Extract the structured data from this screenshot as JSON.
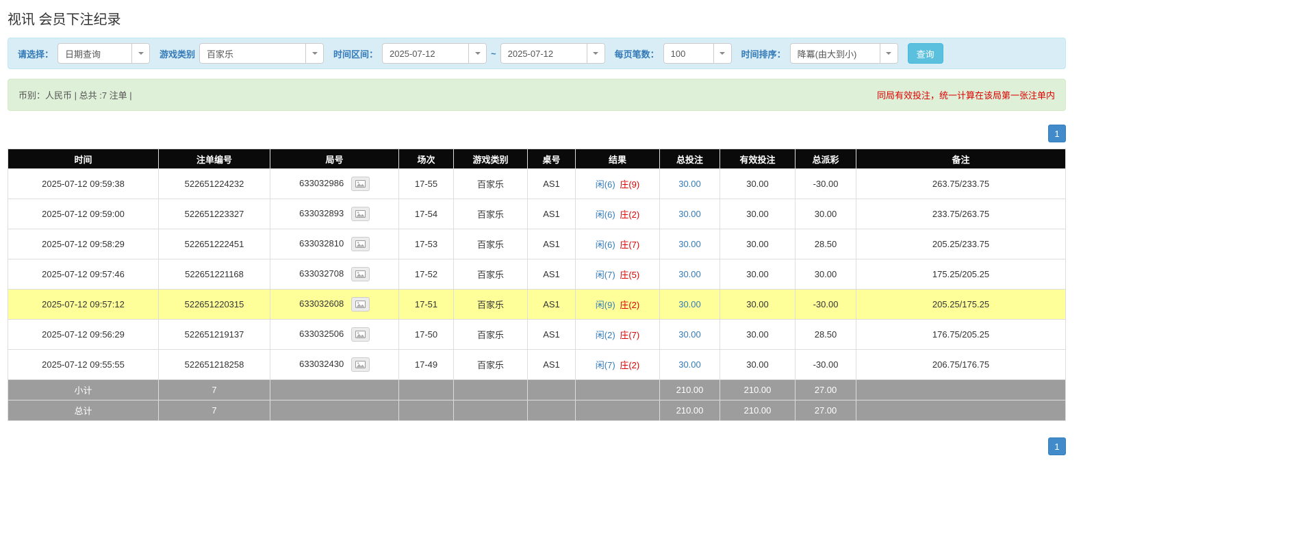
{
  "page": {
    "title": "视讯 会员下注纪录"
  },
  "filter": {
    "select_label": "请选择：",
    "select_value": "日期查询",
    "game_label": "游戏类别",
    "game_value": "百家乐",
    "range_label": "时间区间：",
    "date_from": "2025-07-12",
    "tilde": "~",
    "date_to": "2025-07-12",
    "page_size_label": "每页笔数：",
    "page_size_value": "100",
    "sort_label": "时间排序：",
    "sort_value": "降冪(由大到小)",
    "search_label": "查询"
  },
  "summary": {
    "currency_text": "币别：人民币 | 总共 :7 注单 |",
    "notice_text": "同局有效投注，统一计算在该局第一张注单内"
  },
  "pagination": {
    "page_label": "1"
  },
  "table": {
    "headers": [
      "时间",
      "注单编号",
      "局号",
      "场次",
      "游戏类别",
      "桌号",
      "结果",
      "总投注",
      "有效投注",
      "总派彩",
      "备注"
    ],
    "rows": [
      {
        "time": "2025-07-12 09:59:38",
        "bet_id": "522651224232",
        "round_id": "633032986",
        "session": "17-55",
        "game": "百家乐",
        "table_no": "AS1",
        "result_player": "闲(6)",
        "result_banker": "庄(9)",
        "total_bet": "30.00",
        "valid_bet": "30.00",
        "payout": "-30.00",
        "remark": "263.75/233.75",
        "highlighted": false
      },
      {
        "time": "2025-07-12 09:59:00",
        "bet_id": "522651223327",
        "round_id": "633032893",
        "session": "17-54",
        "game": "百家乐",
        "table_no": "AS1",
        "result_player": "闲(6)",
        "result_banker": "庄(2)",
        "total_bet": "30.00",
        "valid_bet": "30.00",
        "payout": "30.00",
        "remark": "233.75/263.75",
        "highlighted": false
      },
      {
        "time": "2025-07-12 09:58:29",
        "bet_id": "522651222451",
        "round_id": "633032810",
        "session": "17-53",
        "game": "百家乐",
        "table_no": "AS1",
        "result_player": "闲(6)",
        "result_banker": "庄(7)",
        "total_bet": "30.00",
        "valid_bet": "30.00",
        "payout": "28.50",
        "remark": "205.25/233.75",
        "highlighted": false
      },
      {
        "time": "2025-07-12 09:57:46",
        "bet_id": "522651221168",
        "round_id": "633032708",
        "session": "17-52",
        "game": "百家乐",
        "table_no": "AS1",
        "result_player": "闲(7)",
        "result_banker": "庄(5)",
        "total_bet": "30.00",
        "valid_bet": "30.00",
        "payout": "30.00",
        "remark": "175.25/205.25",
        "highlighted": false
      },
      {
        "time": "2025-07-12 09:57:12",
        "bet_id": "522651220315",
        "round_id": "633032608",
        "session": "17-51",
        "game": "百家乐",
        "table_no": "AS1",
        "result_player": "闲(9)",
        "result_banker": "庄(2)",
        "total_bet": "30.00",
        "valid_bet": "30.00",
        "payout": "-30.00",
        "remark": "205.25/175.25",
        "highlighted": true
      },
      {
        "time": "2025-07-12 09:56:29",
        "bet_id": "522651219137",
        "round_id": "633032506",
        "session": "17-50",
        "game": "百家乐",
        "table_no": "AS1",
        "result_player": "闲(2)",
        "result_banker": "庄(7)",
        "total_bet": "30.00",
        "valid_bet": "30.00",
        "payout": "28.50",
        "remark": "176.75/205.25",
        "highlighted": false
      },
      {
        "time": "2025-07-12 09:55:55",
        "bet_id": "522651218258",
        "round_id": "633032430",
        "session": "17-49",
        "game": "百家乐",
        "table_no": "AS1",
        "result_player": "闲(7)",
        "result_banker": "庄(2)",
        "total_bet": "30.00",
        "valid_bet": "30.00",
        "payout": "-30.00",
        "remark": "206.75/176.75",
        "highlighted": false
      }
    ],
    "subtotal": {
      "label": "小计",
      "count": "7",
      "total_bet": "210.00",
      "valid_bet": "210.00",
      "payout": "27.00"
    },
    "total": {
      "label": "总计",
      "count": "7",
      "total_bet": "210.00",
      "valid_bet": "210.00",
      "payout": "27.00"
    }
  },
  "colors": {
    "accent_blue": "#337ab7",
    "button_info_blue": "#5bc0de",
    "pagination_blue": "#428bca",
    "player_blue": "#337ab7",
    "banker_red": "#dd0000",
    "negative_red": "#e60000",
    "notice_red": "#dd0000",
    "highlight_yellow": "#ffff99",
    "filter_bg": "#d9edf7",
    "summary_bg": "#dff0d8",
    "header_bg": "#0a0a0a",
    "footer_bg": "#9d9d9d"
  }
}
